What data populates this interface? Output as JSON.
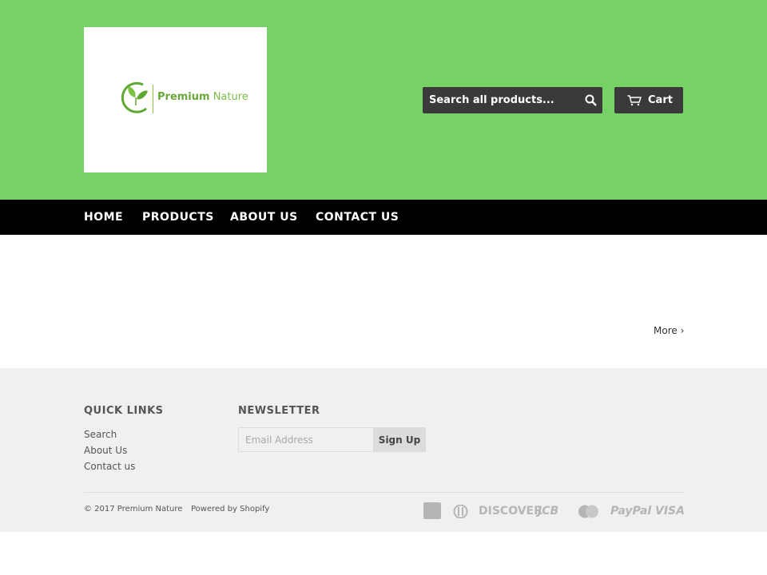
{
  "brand": {
    "name_part1": "Premium",
    "name_part2": "Nature"
  },
  "header": {
    "search_placeholder": "Search all products...",
    "cart_label": "Cart"
  },
  "nav": {
    "items": [
      "HOME",
      "PRODUCTS",
      "ABOUT US",
      "CONTACT US"
    ]
  },
  "main": {
    "more_label": "More ›"
  },
  "footer": {
    "quick_links_title": "QUICK LINKS",
    "quick_links": [
      "Search",
      "About Us",
      "Contact us"
    ],
    "newsletter_title": "NEWSLETTER",
    "email_placeholder": "Email Address",
    "signup_label": "Sign Up",
    "copyright": "© 2017 Premium Nature",
    "powered_by": "Powered by Shopify",
    "payment_icons": [
      "amex-icon",
      "diners-icon",
      "discover-icon",
      "jcb-icon",
      "mastercard-icon",
      "paypal-icon",
      "visa-icon"
    ],
    "payment_text": {
      "discover": "DISCOVER",
      "jcb": "JCB",
      "paypal": "PayPal",
      "visa": "VISA"
    }
  },
  "colors": {
    "header_bg": "#76d166",
    "nav_bg": "#000000",
    "button_bg": "#3a3a3a",
    "footer_bg": "#f0f0f0",
    "logo_green": "#6fb63a"
  }
}
